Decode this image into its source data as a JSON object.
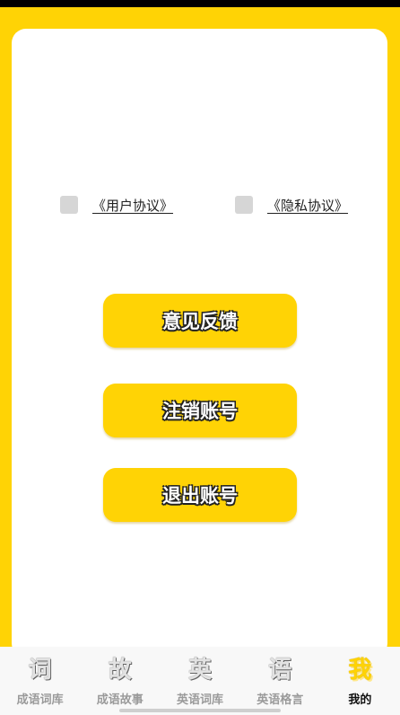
{
  "agreements": {
    "user_agreement": "《用户协议》",
    "privacy_agreement": "《隐私协议》"
  },
  "buttons": {
    "feedback": "意见反馈",
    "cancel_account": "注销账号",
    "logout": "退出账号"
  },
  "tabbar": {
    "tabs": [
      {
        "icon_char": "词",
        "label": "成语词库",
        "icon": "idiom-dictionary-icon"
      },
      {
        "icon_char": "故",
        "label": "成语故事",
        "icon": "idiom-story-icon"
      },
      {
        "icon_char": "英",
        "label": "英语词库",
        "icon": "english-dictionary-icon"
      },
      {
        "icon_char": "语",
        "label": "英语格言",
        "icon": "english-quotes-icon"
      },
      {
        "icon_char": "我",
        "label": "我的",
        "icon": "profile-icon"
      }
    ],
    "active_index": 4
  },
  "colors": {
    "accent": "#FFD305",
    "card": "#FFFFFF",
    "checkbox": "#D6D6D6"
  }
}
